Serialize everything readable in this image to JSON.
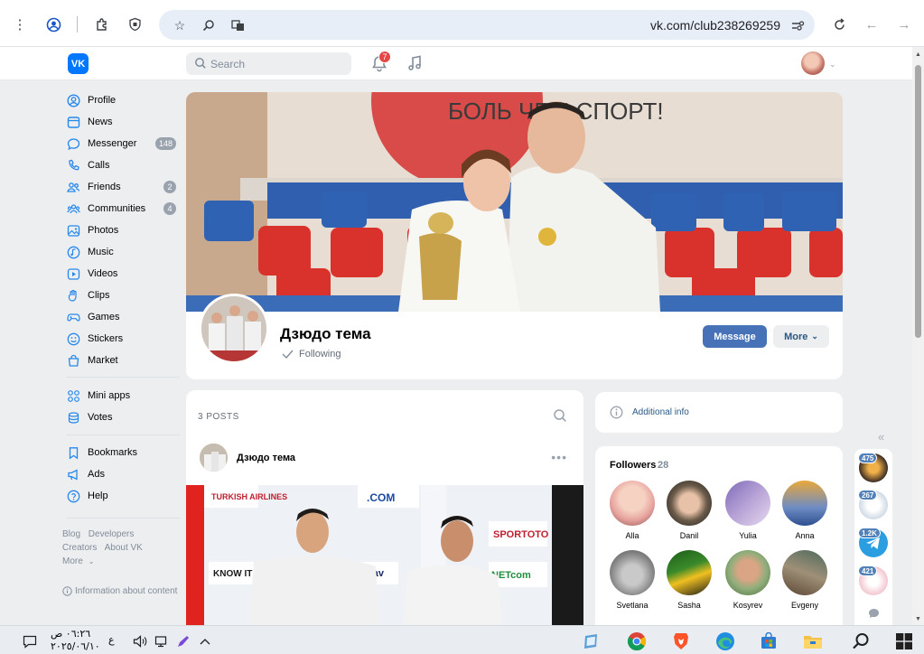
{
  "browser": {
    "url": "vk.com/club238269259"
  },
  "header": {
    "search_placeholder": "Search",
    "notifications_count": "7"
  },
  "sidebar": {
    "items": [
      {
        "label": "Profile",
        "icon": "user-circle-icon"
      },
      {
        "label": "News",
        "icon": "news-icon"
      },
      {
        "label": "Messenger",
        "icon": "message-icon",
        "badge": "148"
      },
      {
        "label": "Calls",
        "icon": "phone-icon"
      },
      {
        "label": "Friends",
        "icon": "friends-icon",
        "badge": "2"
      },
      {
        "label": "Communities",
        "icon": "communities-icon",
        "badge": "4"
      },
      {
        "label": "Photos",
        "icon": "photo-icon"
      },
      {
        "label": "Music",
        "icon": "music-icon"
      },
      {
        "label": "Videos",
        "icon": "video-icon"
      },
      {
        "label": "Clips",
        "icon": "clips-icon"
      },
      {
        "label": "Games",
        "icon": "gamepad-icon"
      },
      {
        "label": "Stickers",
        "icon": "sticker-icon"
      },
      {
        "label": "Market",
        "icon": "bag-icon"
      },
      {
        "label": "Mini apps",
        "icon": "grid-icon"
      },
      {
        "label": "Votes",
        "icon": "coins-icon"
      },
      {
        "label": "Bookmarks",
        "icon": "bookmark-icon"
      },
      {
        "label": "Ads",
        "icon": "megaphone-icon"
      },
      {
        "label": "Help",
        "icon": "help-icon"
      }
    ],
    "footer_links": [
      "Blog",
      "Developers",
      "Creators",
      "About VK",
      "More"
    ],
    "info_content": "Information about content"
  },
  "group": {
    "name": "Дзюдо тема",
    "following_label": "Following",
    "message_button": "Message",
    "more_button": "More",
    "cover_text": "БОЛЬ     ЧЕМ СПОРТ!"
  },
  "posts": {
    "count_label": "3 POSTS",
    "author": "Дзюдо тема",
    "image_banners": [
      "TURKISH AIRLINES",
      "SPORTOTO",
      "triglav",
      "NETcom",
      ".COM",
      "KNOW IT"
    ]
  },
  "right": {
    "additional_info": "Additional info",
    "followers_title": "Followers",
    "followers_count": "28",
    "followers": [
      {
        "name": "Alla",
        "color": "#e8a5a0"
      },
      {
        "name": "Danil",
        "color": "#6b5b4a"
      },
      {
        "name": "Yulia",
        "color": "#b7a3d6"
      },
      {
        "name": "Anna",
        "color": "#6e8cc4"
      },
      {
        "name": "Svetlana",
        "color": "#8c8c8c"
      },
      {
        "name": "Sasha",
        "color": "#3a8a2a"
      },
      {
        "name": "Kosyrev",
        "color": "#8fae7b"
      },
      {
        "name": "Evgeny",
        "color": "#9f8f77"
      }
    ]
  },
  "mini_apps": [
    {
      "badge": "475",
      "color": "#3b2a22"
    },
    {
      "badge": "267",
      "color": "#c9d4e0"
    },
    {
      "badge": "1.2K",
      "color": "#2a9ee0"
    },
    {
      "badge": "421",
      "color": "#f2c6d0"
    }
  ],
  "taskbar": {
    "time": "٠٦:٢٦ ص",
    "date": "٢٠٢٥/٠٦/١٠",
    "lang": "ع"
  },
  "colors": {
    "vk_blue": "#0077ff",
    "button_blue": "#4872b8",
    "link_blue": "#2a5885",
    "badge_red": "#e64646",
    "page_bg": "#edeef0"
  }
}
